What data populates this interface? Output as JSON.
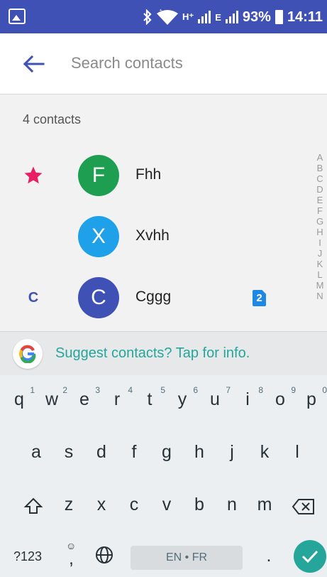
{
  "status_bar": {
    "signal_label_1": "H⁺",
    "signal_label_2": "E",
    "battery_percent": "93%",
    "time": "14:11"
  },
  "search": {
    "placeholder": "Search contacts"
  },
  "contacts": {
    "count_label": "4 contacts",
    "items": [
      {
        "marker": "★",
        "avatar_letter": "F",
        "avatar_color": "#1e9e50",
        "name": "Fhh"
      },
      {
        "marker": "",
        "avatar_letter": "X",
        "avatar_color": "#1ea1e8",
        "name": "Xvhh"
      },
      {
        "marker": "C",
        "avatar_letter": "C",
        "avatar_color": "#3f51b5",
        "name": "Cggg",
        "sim_badge": "2"
      }
    ],
    "alphabet_index": [
      "A",
      "B",
      "C",
      "D",
      "E",
      "F",
      "G",
      "H",
      "I",
      "J",
      "K",
      "L",
      "M",
      "N"
    ]
  },
  "suggestion": {
    "text": "Suggest contacts? Tap for info."
  },
  "keyboard": {
    "row1": [
      {
        "key": "q",
        "hint": "1"
      },
      {
        "key": "w",
        "hint": "2"
      },
      {
        "key": "e",
        "hint": "3"
      },
      {
        "key": "r",
        "hint": "4"
      },
      {
        "key": "t",
        "hint": "5"
      },
      {
        "key": "y",
        "hint": "6"
      },
      {
        "key": "u",
        "hint": "7"
      },
      {
        "key": "i",
        "hint": "8"
      },
      {
        "key": "o",
        "hint": "9"
      },
      {
        "key": "p",
        "hint": "0"
      }
    ],
    "row2": [
      "a",
      "s",
      "d",
      "f",
      "g",
      "h",
      "j",
      "k",
      "l"
    ],
    "row3": [
      "z",
      "x",
      "c",
      "v",
      "b",
      "n",
      "m"
    ],
    "symbols_key": "?123",
    "comma_key": ",",
    "period_key": ".",
    "space_label": "EN • FR"
  },
  "colors": {
    "accent": "#3f51b5",
    "teal": "#26a69a",
    "star": "#e91e63"
  }
}
